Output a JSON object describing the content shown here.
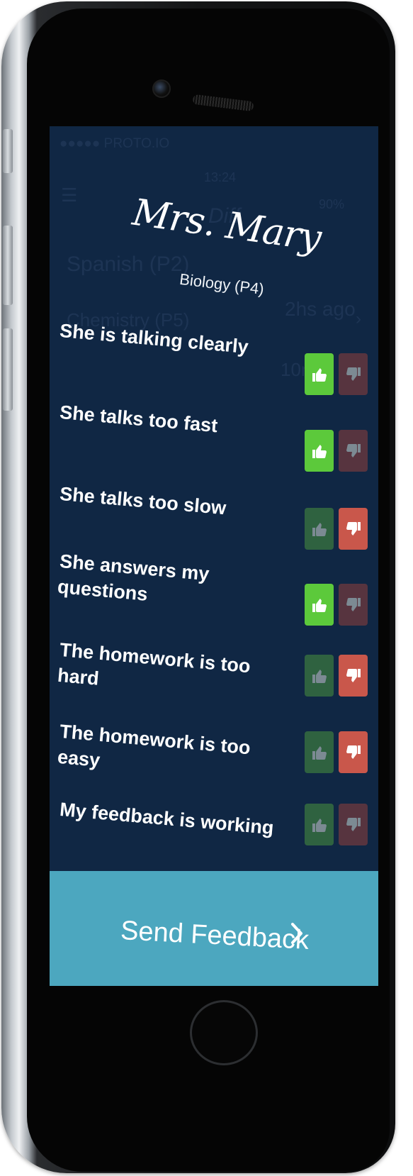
{
  "status_bar_ghost": {
    "carrier": "●●●●● PROTO.IO",
    "time": "13:24",
    "battery": "90%"
  },
  "background_ghost": {
    "app_title": "Diff",
    "row1_class": "Spanish (P2)",
    "row1_time": "2hs ago",
    "row2_class": "Chemistry (P5)",
    "row2_time": "10m"
  },
  "header": {
    "teacher_name": "Mrs. Mary",
    "class_name": "Biology (P4)"
  },
  "questions": [
    {
      "text": "She is talking clearly",
      "vote": "up"
    },
    {
      "text": "She talks too fast",
      "vote": "up"
    },
    {
      "text": "She talks too slow",
      "vote": "down"
    },
    {
      "text": "She answers my questions",
      "vote": "up"
    },
    {
      "text": "The homework is too hard",
      "vote": "down"
    },
    {
      "text": "The homework is too easy",
      "vote": "down"
    },
    {
      "text": "My feedback is working",
      "vote": "none"
    }
  ],
  "footer": {
    "send_label": "Send Feedback",
    "send_icon": "chevron-right-icon"
  },
  "icons": {
    "up": "thumbs-up-icon",
    "down": "thumbs-down-icon"
  },
  "colors": {
    "screen_bg": "#102744",
    "thumb_up_active": "#5cc93b",
    "thumb_up_inactive": "#2f6240",
    "thumb_down_active": "#c9574b",
    "thumb_down_inactive": "#57343f",
    "send_button": "#4ca7bf"
  }
}
